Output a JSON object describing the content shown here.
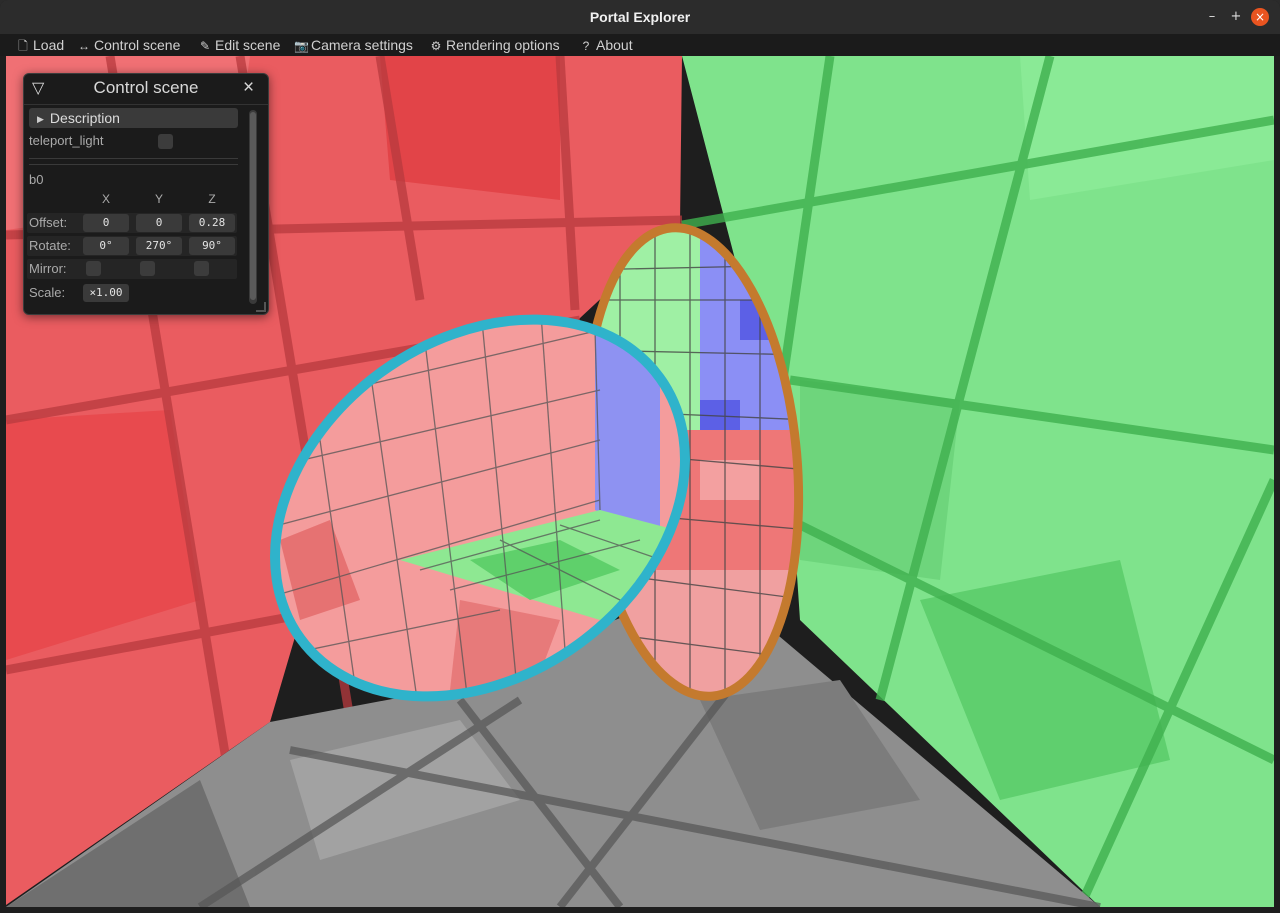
{
  "window": {
    "title": "Portal Explorer",
    "controls": {
      "minimize": "–",
      "maximize": "+",
      "close": "×"
    }
  },
  "menu": [
    {
      "icon": "🗋",
      "label": "Load"
    },
    {
      "icon": "↔",
      "label": "Control scene"
    },
    {
      "icon": "✎",
      "label": "Edit scene"
    },
    {
      "icon": "📷",
      "label": "Camera settings"
    },
    {
      "icon": "⚙",
      "label": "Rendering options"
    },
    {
      "icon": "?",
      "label": "About"
    }
  ],
  "panel": {
    "collapse_glyph": "▽",
    "title": "Control scene",
    "close_glyph": "×",
    "description_label": "Description",
    "teleport_light_label": "teleport_light",
    "teleport_light_checked": false,
    "section_label": "b0",
    "axes": [
      "X",
      "Y",
      "Z"
    ],
    "offset": {
      "label": "Offset:",
      "values": [
        "0",
        "0",
        "0.28"
      ]
    },
    "rotate": {
      "label": "Rotate:",
      "values": [
        "0°",
        "270°",
        "90°"
      ]
    },
    "mirror": {
      "label": "Mirror:",
      "values": [
        false,
        false,
        false
      ]
    },
    "scale": {
      "label": "Scale:",
      "value": "×1.00"
    }
  },
  "colors": {
    "red_wall": "#e8565a",
    "green_wall": "#6fdc7c",
    "gray_floor": "#8c8c8c",
    "portal_blue_ring": "#2ab0c8",
    "portal_orange_ring": "#c97b2c",
    "blue_inner": "#7a7ef0"
  }
}
